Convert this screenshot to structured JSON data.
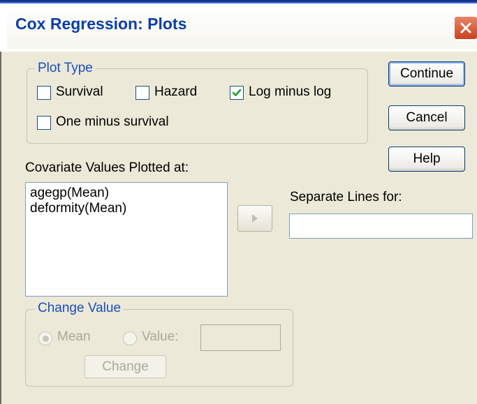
{
  "window": {
    "title": "Cox Regression: Plots"
  },
  "plot_type": {
    "legend": "Plot Type",
    "options": [
      {
        "label": "Survival",
        "checked": false
      },
      {
        "label": "Hazard",
        "checked": false
      },
      {
        "label": "Log minus log",
        "checked": true
      },
      {
        "label": "One minus survival",
        "checked": false
      }
    ]
  },
  "buttons": {
    "continue": "Continue",
    "cancel": "Cancel",
    "help": "Help"
  },
  "covariates": {
    "label": "Covariate Values Plotted at:",
    "items": [
      "agegp(Mean)",
      "deformity(Mean)"
    ]
  },
  "separate_lines": {
    "label": "Separate Lines for:",
    "value": ""
  },
  "change_value": {
    "legend": "Change Value",
    "mean_label": "Mean",
    "value_label": "Value:",
    "value_field": "",
    "change_label": "Change",
    "selected": "mean"
  },
  "colors": {
    "title_text": "#0b3fa7",
    "dialog_bg": "#ece9d8",
    "legend_text": "#1a4fbd",
    "disabled_text": "#aca899"
  },
  "icons": {
    "close": "close-icon",
    "arrow": "right-arrow-icon",
    "check": "checkmark-icon"
  }
}
